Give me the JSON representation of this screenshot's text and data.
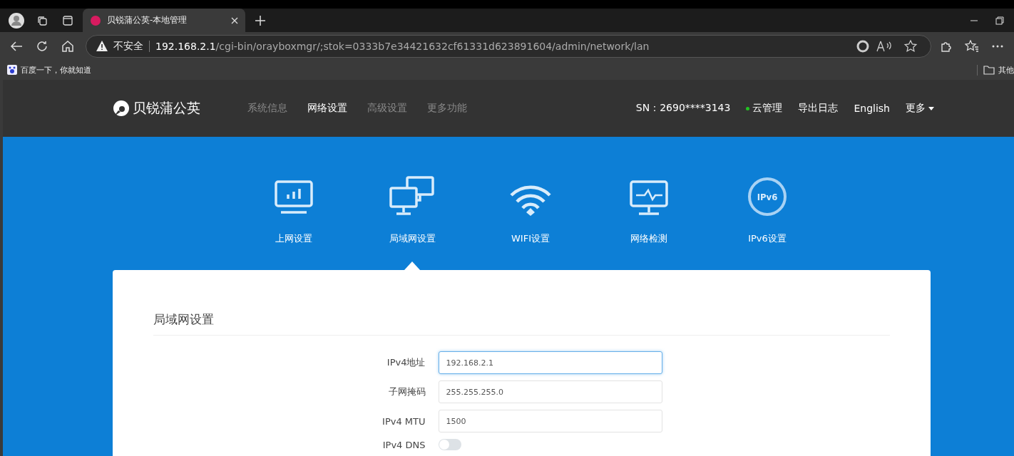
{
  "browser": {
    "tab_title": "贝锐蒲公英-本地管理",
    "security": "不安全",
    "url_host": "192.168.2.1",
    "url_path": "/cgi-bin/orayboxmgr/;stok=0333b7e34421632cf61331d623891604/admin/network/lan",
    "bookmarks": [
      {
        "label": "百度一下，你就知道"
      }
    ],
    "other_bookmarks": "其他"
  },
  "header": {
    "logo": "贝锐蒲公英",
    "nav": [
      {
        "label": "系统信息",
        "selected": false
      },
      {
        "label": "网络设置",
        "selected": true
      },
      {
        "label": "高级设置",
        "selected": false
      },
      {
        "label": "更多功能",
        "selected": false
      }
    ],
    "sn": "SN：2690****3143",
    "cloud": {
      "label": "云管理",
      "color": "#22c322"
    },
    "export_log": "导出日志",
    "language": "English",
    "more": "更多"
  },
  "features": [
    {
      "kind": "internet",
      "label": "上网设置",
      "selected": false
    },
    {
      "kind": "lan",
      "label": "局域网设置",
      "selected": true
    },
    {
      "kind": "wifi",
      "label": "WIFI设置",
      "selected": false
    },
    {
      "kind": "detect",
      "label": "网络检测",
      "selected": false
    },
    {
      "kind": "ipv6",
      "label": "IPv6设置",
      "icon_text": "IPv6",
      "selected": false
    }
  ],
  "panel": {
    "title": "局域网设置",
    "fields": [
      {
        "kind": "input",
        "label": "IPv4地址",
        "value": "192.168.2.1",
        "focused": true
      },
      {
        "kind": "input",
        "label": "子网掩码",
        "value": "255.255.255.0",
        "focused": false
      },
      {
        "kind": "input",
        "label": "IPv4 MTU",
        "value": "1500",
        "focused": false
      },
      {
        "kind": "toggle",
        "label": "IPv4 DNS",
        "on": false
      }
    ]
  }
}
